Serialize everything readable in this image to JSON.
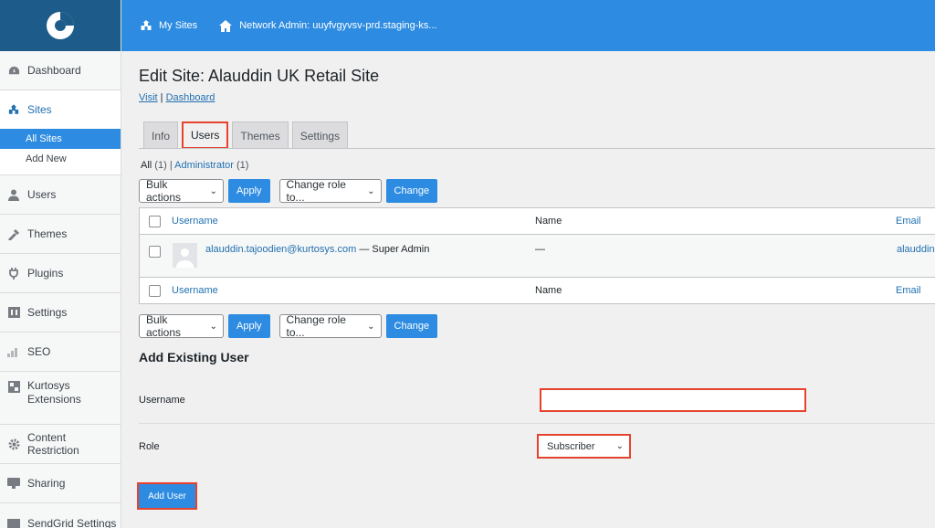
{
  "topbar": {
    "my_sites": "My Sites",
    "network_admin": "Network Admin: uuyfvgyvsv-prd.staging-ks..."
  },
  "sidebar": {
    "items": [
      {
        "label": "Dashboard",
        "icon": "dashboard-icon"
      },
      {
        "label": "Sites",
        "icon": "sites-icon"
      },
      {
        "label": "Users",
        "icon": "users-icon"
      },
      {
        "label": "Themes",
        "icon": "themes-icon"
      },
      {
        "label": "Plugins",
        "icon": "plugins-icon"
      },
      {
        "label": "Settings",
        "icon": "settings-icon"
      },
      {
        "label": "SEO",
        "icon": "seo-icon"
      },
      {
        "label": "Kurtosys Extensions",
        "icon": "extensions-icon"
      },
      {
        "label": "Content Restriction",
        "icon": "gear-icon"
      },
      {
        "label": "Sharing",
        "icon": "sharing-icon"
      },
      {
        "label": "SendGrid Settings",
        "icon": "mail-icon"
      }
    ],
    "sites_submenu": [
      "All Sites",
      "Add New"
    ]
  },
  "page": {
    "title": "Edit Site: Alauddin UK Retail Site",
    "visit_link": "Visit",
    "separator": "|",
    "dashboard_link": "Dashboard"
  },
  "tabs": [
    "Info",
    "Users",
    "Themes",
    "Settings"
  ],
  "filter": {
    "all_label": "All",
    "all_count": "(1)",
    "separator": "|",
    "admin_label": "Administrator",
    "admin_count": "(1)"
  },
  "bulk": {
    "select": "Bulk actions",
    "apply": "Apply",
    "role_select": "Change role to...",
    "change": "Change"
  },
  "table": {
    "columns": {
      "username": "Username",
      "name": "Name",
      "email": "Email"
    },
    "rows": [
      {
        "username": "alauddin.tajoodien@kurtosys.com",
        "role": "— Super Admin",
        "name": "—",
        "email": "alauddin..."
      }
    ]
  },
  "add_existing": {
    "title": "Add Existing User",
    "username_label": "Username",
    "username_value": "",
    "role_label": "Role",
    "role_value": "Subscriber",
    "submit": "Add User"
  },
  "colors": {
    "primary": "#2d8ce1",
    "logo_bg": "#1d5c8a",
    "highlight": "#e6432f",
    "link": "#2271b1"
  }
}
